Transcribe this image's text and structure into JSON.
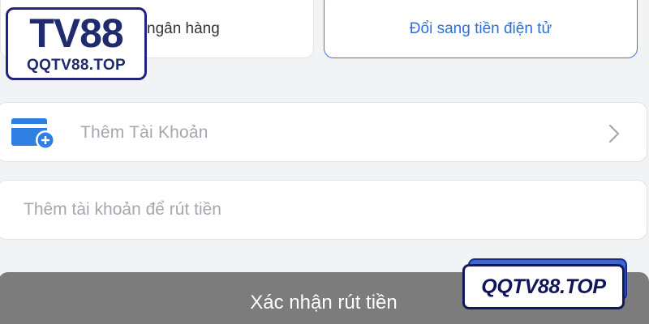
{
  "tabs": {
    "bank_label": "ngân hàng",
    "crypto_label": "Đổi sang tiền điện tử"
  },
  "add_account": {
    "label": "Thêm Tài Khoản",
    "icon": "wallet-add-icon"
  },
  "withdraw_input": {
    "placeholder": "Thêm tài khoản để rút tiền",
    "value": ""
  },
  "confirm": {
    "label": "Xác nhận rút tiền"
  },
  "logo": {
    "main": "TV88",
    "sub": "QQTV88.TOP"
  },
  "watermark": {
    "text": "QQTV88.TOP"
  },
  "colors": {
    "accent": "#2f6fd6",
    "icon_blue": "#2f7fe3",
    "button_gray": "#7c7c7c",
    "logo_navy": "#1f2b6e"
  }
}
